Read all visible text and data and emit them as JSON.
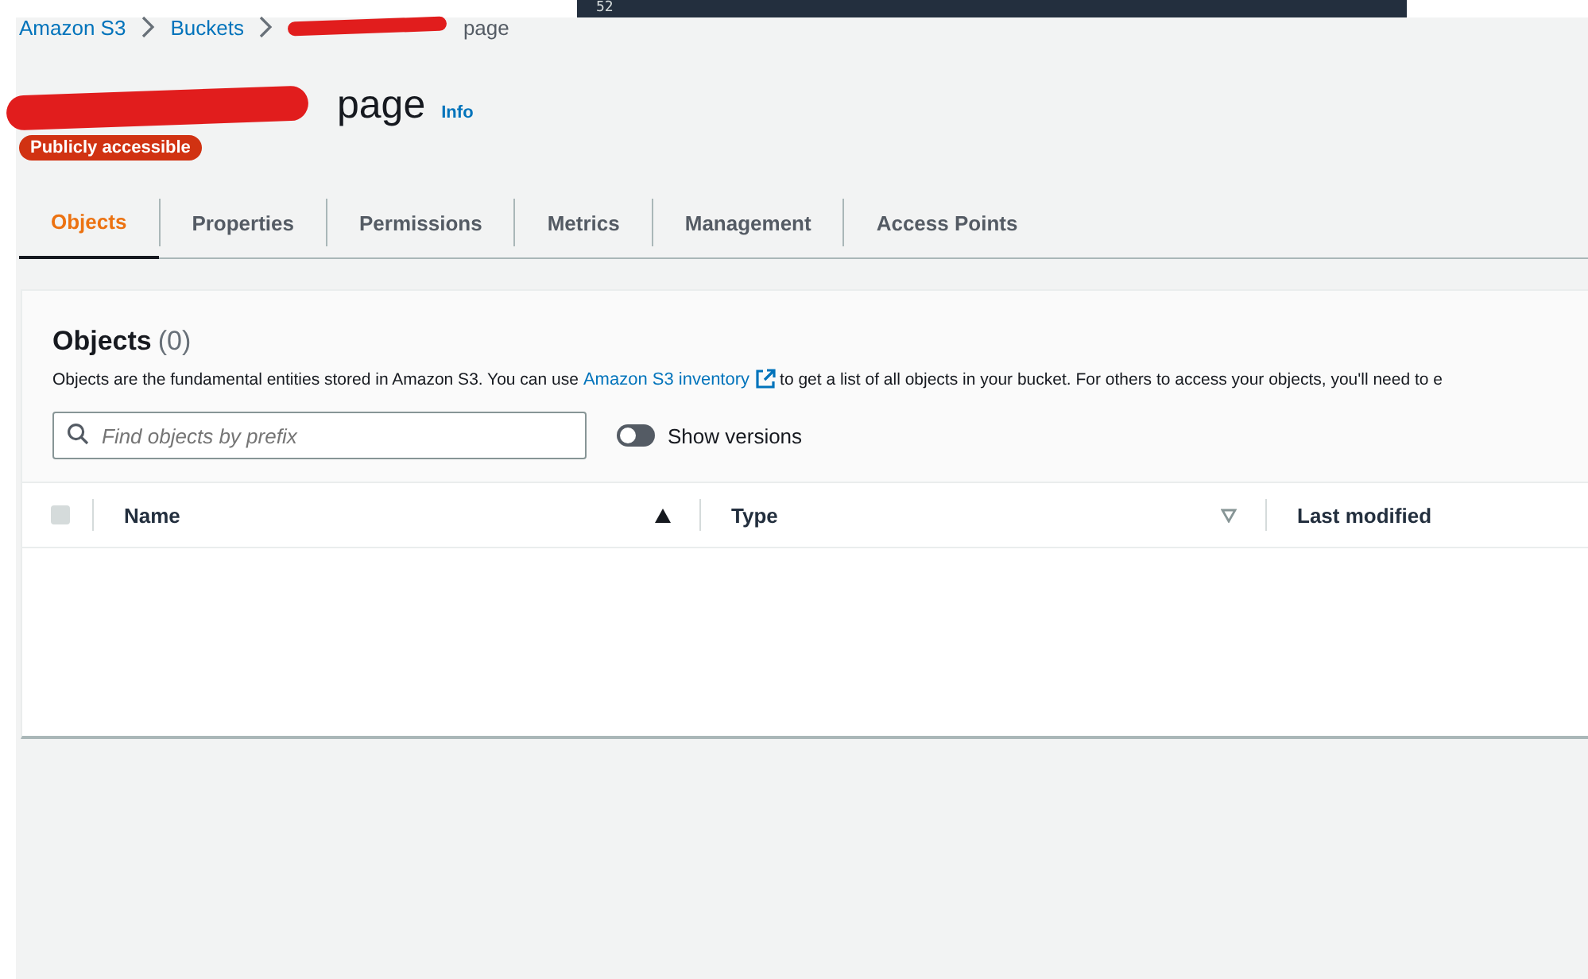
{
  "top_strip": {
    "line_number": "52"
  },
  "breadcrumbs": [
    {
      "label": "Amazon S3",
      "kind": "link"
    },
    {
      "label": "Buckets",
      "kind": "link"
    },
    {
      "label": "page",
      "kind": "current"
    }
  ],
  "bucket": {
    "title": "page",
    "info_link": "Info",
    "badge": "Publicly accessible"
  },
  "tabs": [
    {
      "label": "Objects",
      "selected": true
    },
    {
      "label": "Properties",
      "selected": false
    },
    {
      "label": "Permissions",
      "selected": false
    },
    {
      "label": "Metrics",
      "selected": false
    },
    {
      "label": "Management",
      "selected": false
    },
    {
      "label": "Access Points",
      "selected": false
    }
  ],
  "objects_panel": {
    "title": "Objects",
    "count": "(0)",
    "description_before": "Objects are the fundamental entities stored in Amazon S3. You can use",
    "description_link": "Amazon S3 inventory",
    "description_after": "to get a list of all objects in your bucket. For others to access your objects, you'll need to e",
    "search": {
      "placeholder": "Find objects by prefix"
    },
    "show_versions": {
      "label": "Show versions",
      "on": false
    },
    "table": {
      "select_all_checked": false,
      "columns": [
        {
          "label": "Name",
          "sorted": true
        },
        {
          "label": "Type",
          "sorted": false
        },
        {
          "label": "Last modified"
        }
      ]
    }
  }
}
